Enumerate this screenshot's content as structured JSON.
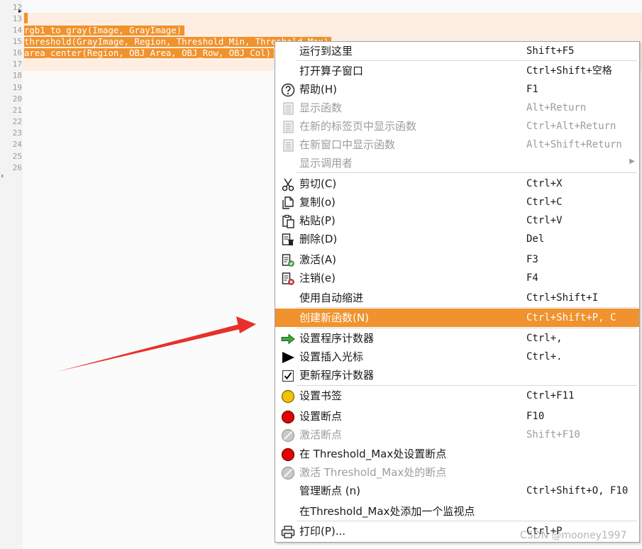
{
  "editor": {
    "line_numbers": [
      "12",
      "13",
      "14",
      "15",
      "16",
      "17",
      "18",
      "19",
      "20",
      "21",
      "22",
      "23",
      "24",
      "25",
      "26"
    ],
    "code_lines": [
      "rgb1_to_gray(Image, GrayImage)",
      "threshold(GrayImage, Region, Threshold_Min, Threshold_Max)",
      "area_center(Region, OBJ_Area, OBJ_Row, OBJ_Col)"
    ],
    "selection_color": "#f0922d"
  },
  "menu": {
    "items": [
      {
        "label": "运行到这里",
        "shortcut": "Shift+F5",
        "icon": "none",
        "enabled": true
      },
      {
        "label": "打开算子窗口",
        "shortcut": "Ctrl+Shift+空格",
        "icon": "none",
        "enabled": true
      },
      {
        "label": "帮助(H)",
        "shortcut": "F1",
        "icon": "help-icon",
        "enabled": true
      },
      {
        "label": "显示函数",
        "shortcut": "Alt+Return",
        "icon": "document-icon",
        "enabled": false
      },
      {
        "label": "在新的标签页中显示函数",
        "shortcut": "Ctrl+Alt+Return",
        "icon": "document-icon",
        "enabled": false
      },
      {
        "label": "在新窗口中显示函数",
        "shortcut": "Alt+Shift+Return",
        "icon": "document-icon",
        "enabled": false
      },
      {
        "label": "显示调用者",
        "shortcut": "",
        "icon": "none",
        "enabled": false
      },
      {
        "label": "剪切(C)",
        "shortcut": "Ctrl+X",
        "icon": "scissors-icon",
        "enabled": true
      },
      {
        "label": "复制(o)",
        "shortcut": "Ctrl+C",
        "icon": "copy-icon",
        "enabled": true
      },
      {
        "label": "粘贴(P)",
        "shortcut": "Ctrl+V",
        "icon": "paste-icon",
        "enabled": true
      },
      {
        "label": "删除(D)",
        "shortcut": "Del",
        "icon": "delete-icon",
        "enabled": true
      },
      {
        "label": "激活(A)",
        "shortcut": "F3",
        "icon": "activate-icon",
        "enabled": true
      },
      {
        "label": "注销(e)",
        "shortcut": "F4",
        "icon": "deactivate-icon",
        "enabled": true
      },
      {
        "label": "使用自动缩进",
        "shortcut": "Ctrl+Shift+I",
        "icon": "none",
        "enabled": true
      },
      {
        "label": "创建新函数(N)",
        "shortcut": "Ctrl+Shift+P, C",
        "icon": "none",
        "enabled": true,
        "highlighted": true
      },
      {
        "label": "设置程序计数器",
        "shortcut": "Ctrl+,",
        "icon": "green-arrow-icon",
        "enabled": true
      },
      {
        "label": "设置插入光标",
        "shortcut": "Ctrl+.",
        "icon": "black-triangle-icon",
        "enabled": true
      },
      {
        "label": "更新程序计数器",
        "shortcut": "",
        "icon": "checkbox-icon",
        "enabled": true
      },
      {
        "label": "设置书签",
        "shortcut": "Ctrl+F11",
        "icon": "bookmark-icon",
        "enabled": true
      },
      {
        "label": "设置断点",
        "shortcut": "F10",
        "icon": "breakpoint-icon",
        "enabled": true
      },
      {
        "label": "激活断点",
        "shortcut": "Shift+F10",
        "icon": "breakpoint-disabled-icon",
        "enabled": false
      },
      {
        "label": "在 Threshold_Max处设置断点",
        "shortcut": "",
        "icon": "breakpoint-icon",
        "enabled": true
      },
      {
        "label": "激活 Threshold_Max处的断点",
        "shortcut": "",
        "icon": "breakpoint-disabled-icon",
        "enabled": false
      },
      {
        "label": "管理断点 (n)",
        "shortcut": "Ctrl+Shift+O, F10",
        "icon": "none",
        "enabled": true
      },
      {
        "label": "在Threshold_Max处添加一个监视点",
        "shortcut": "",
        "icon": "none",
        "enabled": true
      },
      {
        "label": "打印(P)...",
        "shortcut": "Ctrl+P",
        "icon": "printer-icon",
        "enabled": true
      }
    ],
    "highlight_color": "#f0922d"
  },
  "watermark": "CSDN @mooney1997",
  "annotation": {
    "arrow_color": "#e8302a"
  }
}
